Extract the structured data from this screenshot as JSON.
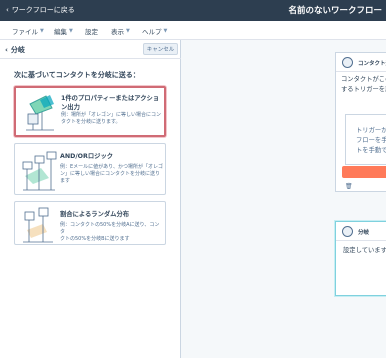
{
  "topbar": {
    "back_label": "ワークフローに戻る",
    "workflow_title": "名前のないワークフロー"
  },
  "menu": {
    "items": [
      "ファイル",
      "編集",
      "設定",
      "表示",
      "ヘルプ"
    ]
  },
  "panel": {
    "title": "分岐",
    "cancel_label": "キャンセル",
    "question": "次に基づいてコンタクトを分岐に送る：",
    "options": [
      {
        "title": "1件のプロパティーまたはアクション出力",
        "desc_lines": [
          "例：場所が「オレゴン」に等しい場合にコン",
          "タクトを分岐に送ります。"
        ],
        "selected": true,
        "icon": "single-branch-illustration"
      },
      {
        "title": "AND/ORロジック",
        "desc_lines": [
          "例：Eメールに値があり、かつ場所が「オレゴ",
          "ン」に等しい場合にコンタクトを分岐に送り",
          "ます"
        ],
        "selected": false,
        "icon": "and-or-branch-illustration"
      },
      {
        "title": "割合によるランダム分布",
        "desc_lines": [
          "例：コンタクトの50%を分岐Aに送り、コンタ",
          "クトの50%を分岐Bに送ります"
        ],
        "selected": false,
        "icon": "random-split-illustration"
      }
    ]
  },
  "canvas": {
    "trigger_card": {
      "title": "コンタクト登",
      "text_lines": [
        "コンタクトがこの",
        "するトリガーを設"
      ],
      "inner_lines": [
        "トリガーが",
        "フローを手",
        "トを手動で"
      ]
    },
    "branch_card": {
      "title": "分岐",
      "text": "設定しています..."
    }
  },
  "colors": {
    "topbar": "#2d3e50",
    "selected_border": "#d06b75",
    "accent_orange": "#ff7a59",
    "illustration_teal": "#00a4bd",
    "illustration_green": "#3da69d"
  }
}
